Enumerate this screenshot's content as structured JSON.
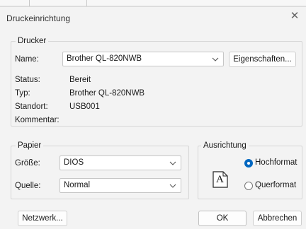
{
  "window": {
    "title": "Druckeinrichtung",
    "close_glyph": "✕"
  },
  "printer": {
    "legend": "Drucker",
    "name_label": "Name:",
    "name_value": "Brother QL-820NWB",
    "properties_button": "Eigenschaften...",
    "status_label": "Status:",
    "status_value": "Bereit",
    "type_label": "Typ:",
    "type_value": "Brother QL-820NWB",
    "location_label": "Standort:",
    "location_value": "USB001",
    "comment_label": "Kommentar:"
  },
  "paper": {
    "legend": "Papier",
    "size_label": "Größe:",
    "size_value": "DIOS",
    "source_label": "Quelle:",
    "source_value": "Normal"
  },
  "orientation": {
    "legend": "Ausrichtung",
    "portrait_label": "Hochformat",
    "landscape_label": "Querformat",
    "selected": "portrait",
    "icon_letter": "A"
  },
  "footer": {
    "network_button": "Netzwerk...",
    "ok_button": "OK",
    "cancel_button": "Abbrechen"
  },
  "icons": {
    "chevron": "chevron-down-icon",
    "close": "close-icon",
    "document": "document-portrait-icon"
  },
  "colors": {
    "accent": "#0067c0",
    "dialog_bg": "#f3f3f3"
  }
}
